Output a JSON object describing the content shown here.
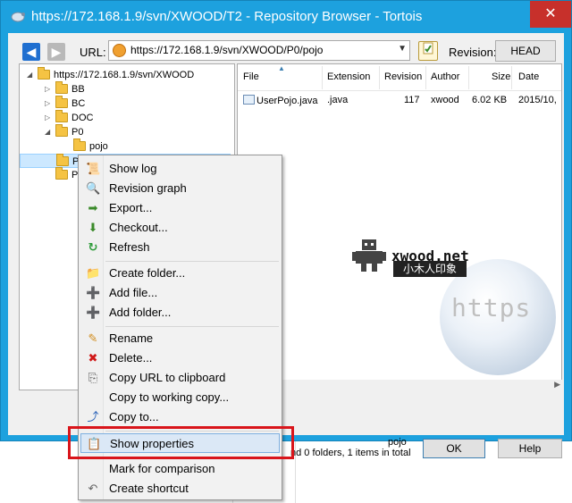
{
  "window": {
    "title": "https://172.168.1.9/svn/XWOOD/T2 - Repository Browser - Tortois",
    "close_glyph": "✕"
  },
  "toolbar": {
    "back_glyph": "◀",
    "forward_glyph": "▶",
    "url_label": "URL:",
    "url_value": "https://172.168.1.9/svn/XWOOD/P0/pojo",
    "url_dropdown_glyph": "▼",
    "revision_label": "Revision:",
    "head_button": "HEAD"
  },
  "tree": {
    "items": [
      {
        "label": "https://172.168.1.9/svn/XWOOD",
        "expander": "◢",
        "depth": 0
      },
      {
        "label": "BB",
        "expander": "▷",
        "depth": 1
      },
      {
        "label": "BC",
        "expander": "▷",
        "depth": 1
      },
      {
        "label": "DOC",
        "expander": "▷",
        "depth": 1
      },
      {
        "label": "P0",
        "expander": "◢",
        "depth": 1
      },
      {
        "label": "pojo",
        "expander": "",
        "depth": 2
      },
      {
        "label": "P1",
        "expander": "",
        "depth": 1
      },
      {
        "label": "P",
        "expander": "",
        "depth": 1
      }
    ]
  },
  "list": {
    "columns": [
      "File",
      "Extension",
      "Revision",
      "Author",
      "Size",
      "Date"
    ],
    "rows": [
      {
        "file": "UserPojo.java",
        "extension": ".java",
        "revision": "117",
        "author": "xwood",
        "size": "6.02 KB",
        "date": "2015/10,"
      }
    ]
  },
  "watermark": {
    "domain": "xwood.net",
    "subtitle": "小木人印象",
    "globe_text": "https"
  },
  "status": {
    "line1": "pojo",
    "line2": "nd 0 folders, 1 items in total"
  },
  "buttons": {
    "ok": "OK",
    "help": "Help"
  },
  "context_menu": {
    "items": [
      {
        "label": "Show log",
        "icon": "show-log-icon",
        "glyph": "📜"
      },
      {
        "label": "Revision graph",
        "icon": "revision-graph-icon",
        "glyph": "🔍"
      },
      {
        "label": "Export...",
        "icon": "export-icon",
        "glyph": "➡"
      },
      {
        "label": "Checkout...",
        "icon": "checkout-icon",
        "glyph": "⬇"
      },
      {
        "label": "Refresh",
        "icon": "refresh-icon",
        "glyph": "↻"
      },
      {
        "label": "Create folder...",
        "icon": "create-folder-icon",
        "glyph": "📁"
      },
      {
        "label": "Add file...",
        "icon": "add-file-icon",
        "glyph": "➕"
      },
      {
        "label": "Add folder...",
        "icon": "add-folder-icon",
        "glyph": "➕"
      },
      {
        "label": "Rename",
        "icon": "rename-icon",
        "glyph": "✎"
      },
      {
        "label": "Delete...",
        "icon": "delete-icon",
        "glyph": "✖"
      },
      {
        "label": "Copy URL to clipboard",
        "icon": "copy-url-icon",
        "glyph": "⎘"
      },
      {
        "label": "Copy to working copy...",
        "icon": "",
        "glyph": ""
      },
      {
        "label": "Copy to...",
        "icon": "copy-to-icon",
        "glyph": "⤴"
      },
      {
        "label": "Show properties",
        "icon": "show-properties-icon",
        "glyph": "📋"
      },
      {
        "label": "Mark for comparison",
        "icon": "",
        "glyph": ""
      },
      {
        "label": "Create shortcut",
        "icon": "create-shortcut-icon",
        "glyph": "↶"
      }
    ]
  },
  "colors": {
    "title_bar": "#1da1de",
    "close_button": "#c7302b",
    "highlight_box": "#d9151b",
    "selection": "#cce8ff"
  }
}
